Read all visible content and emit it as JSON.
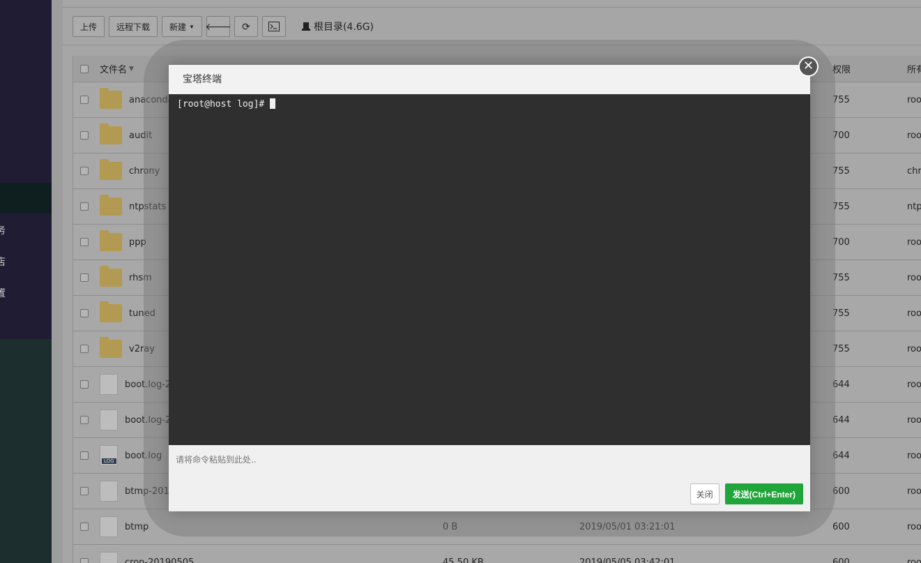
{
  "sidebar": {
    "items": [
      "务",
      "店",
      "置"
    ]
  },
  "toolbar": {
    "upload_label": "上传",
    "remote_download_label": "远程下载",
    "new_label": "新建",
    "breadcrumb_label": "根目录(4.6G)"
  },
  "table": {
    "headers": {
      "name": "文件名",
      "perm": "权限",
      "owner": "所有"
    },
    "rows": [
      {
        "type": "folder",
        "name": "anaconda",
        "size": "",
        "date": "",
        "perm": "755",
        "owner": "root"
      },
      {
        "type": "folder",
        "name": "audit",
        "size": "",
        "date": "",
        "perm": "700",
        "owner": "root"
      },
      {
        "type": "folder",
        "name": "chrony",
        "size": "",
        "date": "",
        "perm": "755",
        "owner": "chrony"
      },
      {
        "type": "folder",
        "name": "ntpstats",
        "size": "",
        "date": "",
        "perm": "755",
        "owner": "ntp"
      },
      {
        "type": "folder",
        "name": "ppp",
        "size": "",
        "date": "",
        "perm": "700",
        "owner": "root"
      },
      {
        "type": "folder",
        "name": "rhsm",
        "size": "",
        "date": "",
        "perm": "755",
        "owner": "root"
      },
      {
        "type": "folder",
        "name": "tuned",
        "size": "",
        "date": "",
        "perm": "755",
        "owner": "root"
      },
      {
        "type": "folder",
        "name": "v2ray",
        "size": "",
        "date": "",
        "perm": "755",
        "owner": "root"
      },
      {
        "type": "file",
        "name": "boot.log-2",
        "size": "",
        "date": "",
        "perm": "644",
        "owner": "root"
      },
      {
        "type": "file",
        "name": "boot.log-2",
        "size": "",
        "date": "",
        "perm": "644",
        "owner": "root"
      },
      {
        "type": "log",
        "name": "boot.log",
        "size": "",
        "date": "",
        "perm": "644",
        "owner": "root"
      },
      {
        "type": "file",
        "name": "btmp-201",
        "size": "",
        "date": "",
        "perm": "600",
        "owner": "root"
      },
      {
        "type": "file",
        "name": "btmp",
        "size": "0 B",
        "date": "2019/05/01 03:21:01",
        "perm": "600",
        "owner": "root"
      },
      {
        "type": "file",
        "name": "cron-20190505",
        "size": "45.50 KB",
        "date": "2019/05/05 03:42:01",
        "perm": "600",
        "owner": "root"
      }
    ]
  },
  "dialog": {
    "title": "宝塔终端",
    "close_glyph": "✕",
    "terminal_prompt": "[root@host log]#",
    "input_placeholder": "请将命令粘贴到此处..",
    "close_button_label": "关闭",
    "send_button_label": "发送(Ctrl+Enter)"
  },
  "colors": {
    "terminal_bg": "#2f2f2f",
    "send_button": "#20a53a"
  }
}
